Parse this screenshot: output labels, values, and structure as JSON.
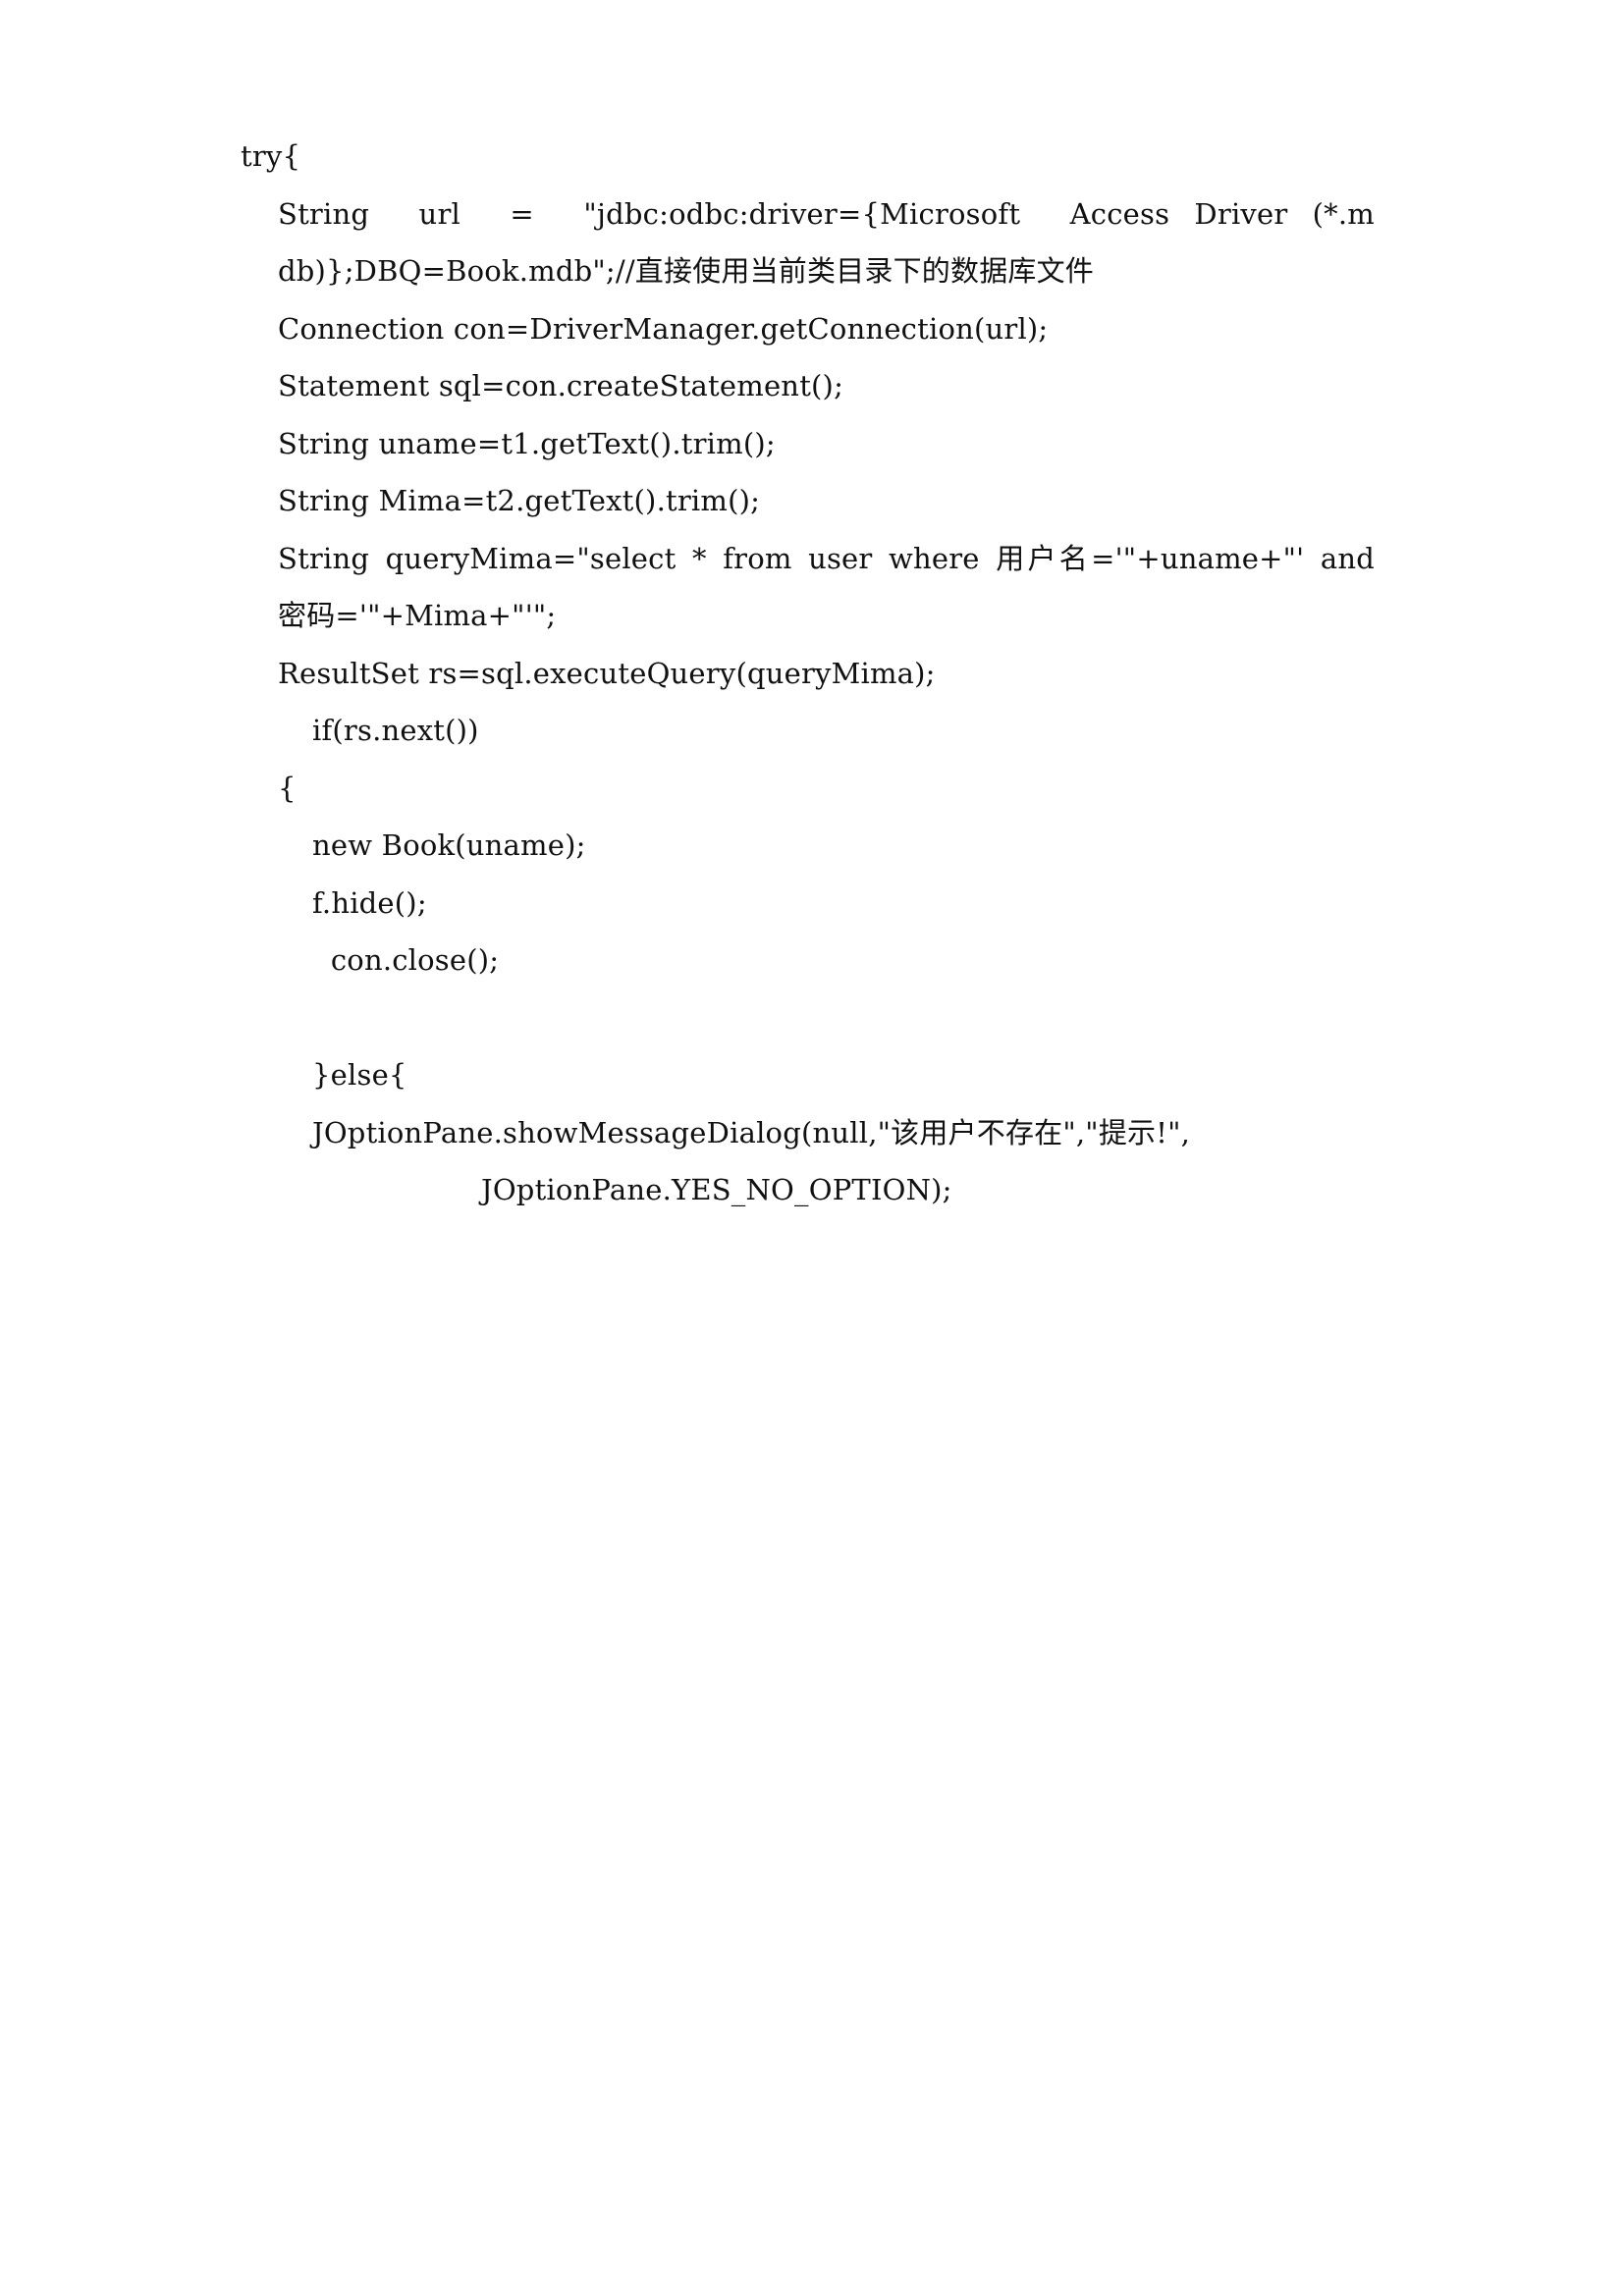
{
  "document": {
    "type": "code-listing-page",
    "language": "java",
    "background_color": "#ffffff",
    "text_color": "#111111",
    "lines": [
      {
        "id": "l1",
        "indent": 1,
        "text": "try{"
      },
      {
        "id": "l2",
        "indent": 2,
        "text": "String  url  =  \"jdbc:odbc:driver={Microsoft  Access Driver (*.mdb)};DBQ=Book.mdb\";//直接使用当前类目录下的数据库文件"
      },
      {
        "id": "l3",
        "indent": 2,
        "text": "Connection con=DriverManager.getConnection(url);"
      },
      {
        "id": "l4",
        "indent": 2,
        "text": "Statement sql=con.createStatement();"
      },
      {
        "id": "l5",
        "indent": 2,
        "text": "String uname=t1.getText().trim();"
      },
      {
        "id": "l6",
        "indent": 2,
        "text": "String Mima=t2.getText().trim();"
      },
      {
        "id": "l7",
        "indent": 2,
        "text": "String queryMima=\"select * from user where 用户名='\"+uname+\"' and 密码='\"+Mima+\"'\";"
      },
      {
        "id": "l8",
        "indent": 2,
        "text": "ResultSet rs=sql.executeQuery(queryMima);"
      },
      {
        "id": "l9",
        "indent": 3,
        "text": "if(rs.next())"
      },
      {
        "id": "l10",
        "indent": 2,
        "text": "{"
      },
      {
        "id": "l11",
        "indent": 3,
        "text": "new Book(uname);"
      },
      {
        "id": "l12",
        "indent": 3,
        "text": "f.hide();"
      },
      {
        "id": "l13",
        "indent": 3,
        "text": "  con.close();"
      },
      {
        "id": "l14",
        "indent": 0,
        "text": ""
      },
      {
        "id": "l15",
        "indent": 3,
        "text": "}else{"
      },
      {
        "id": "l16",
        "indent": 3,
        "text": "JOptionPane.showMessageDialog(null,\"该用户不存在\",\"提示!\","
      },
      {
        "id": "l17",
        "indent": 4,
        "text": "JOptionPane.YES_NO_OPTION);"
      }
    ]
  }
}
